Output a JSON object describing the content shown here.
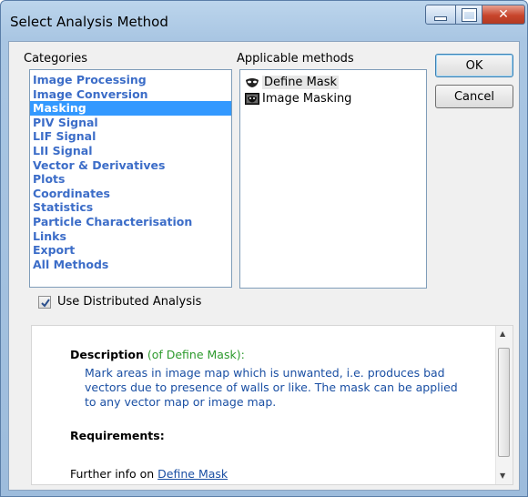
{
  "window": {
    "title": "Select Analysis Method",
    "controls": {
      "minimize_icon": "minimize-icon",
      "maximize_icon": "maximize-icon",
      "close_icon": "close-icon"
    }
  },
  "categories": {
    "label": "Categories",
    "items": [
      "Image Processing",
      "Image Conversion",
      "Masking",
      "PIV Signal",
      "LIF Signal",
      "LII Signal",
      "Vector & Derivatives",
      "Plots",
      "Coordinates",
      "Statistics",
      "Particle Characterisation",
      "Links",
      "Export",
      "All Methods"
    ],
    "selected": "Masking"
  },
  "methods": {
    "label": "Applicable methods",
    "items": [
      {
        "label": "Define Mask",
        "icon": "mask-icon"
      },
      {
        "label": "Image Masking",
        "icon": "image-masking-icon"
      }
    ],
    "selected": "Define Mask"
  },
  "buttons": {
    "ok": "OK",
    "cancel": "Cancel"
  },
  "options": {
    "distributed_label": "Use Distributed Analysis",
    "distributed_checked": true
  },
  "description": {
    "heading": "Description",
    "of_text": "(of Define Mask):",
    "body_lines": [
      "Mark areas in image map which is unwanted, i.e. produces bad",
      "vectors due to presence of walls or like. The mask can be applied",
      "to any vector map or image map."
    ],
    "requirements_label": "Requirements:",
    "further_info_prefix": "Further info on",
    "further_info_link": "Define Mask"
  },
  "colors": {
    "selection": "#3399ff",
    "category_text": "#3c6dc8",
    "link": "#1a4fa3",
    "of_text": "#2d9a2d"
  }
}
